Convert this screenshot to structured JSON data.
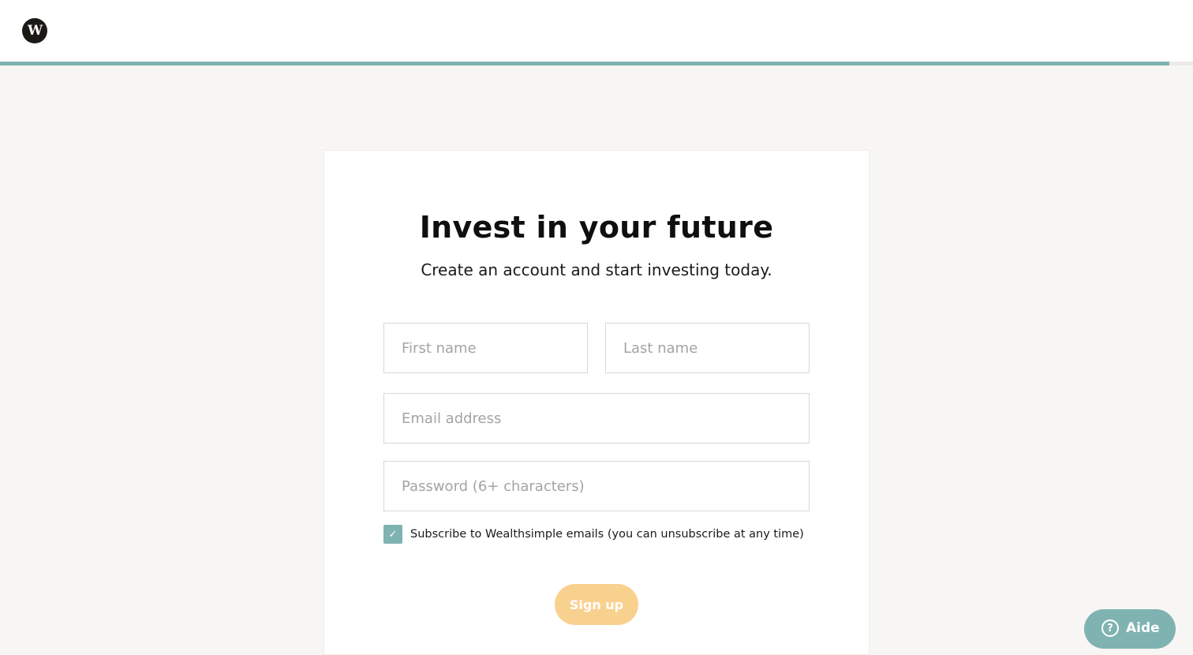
{
  "header": {
    "logo_letter": "W",
    "progress_fraction": 0.98
  },
  "main": {
    "title": "Invest in your future",
    "subtitle": "Create an account and start investing today."
  },
  "form": {
    "first_name_placeholder": "First name",
    "last_name_placeholder": "Last name",
    "email_placeholder": "Email address",
    "password_placeholder": "Password (6+ characters)",
    "subscribe_checked": true,
    "subscribe_label": "Subscribe to Wealthsimple emails (you can unsubscribe at any time)",
    "submit_label": "Sign up"
  },
  "help": {
    "label": "Aide",
    "icon": "question-circle-icon"
  },
  "colors": {
    "accent": "#7fb3b1",
    "button": "#f9d18e",
    "background": "#f7f6f4"
  }
}
